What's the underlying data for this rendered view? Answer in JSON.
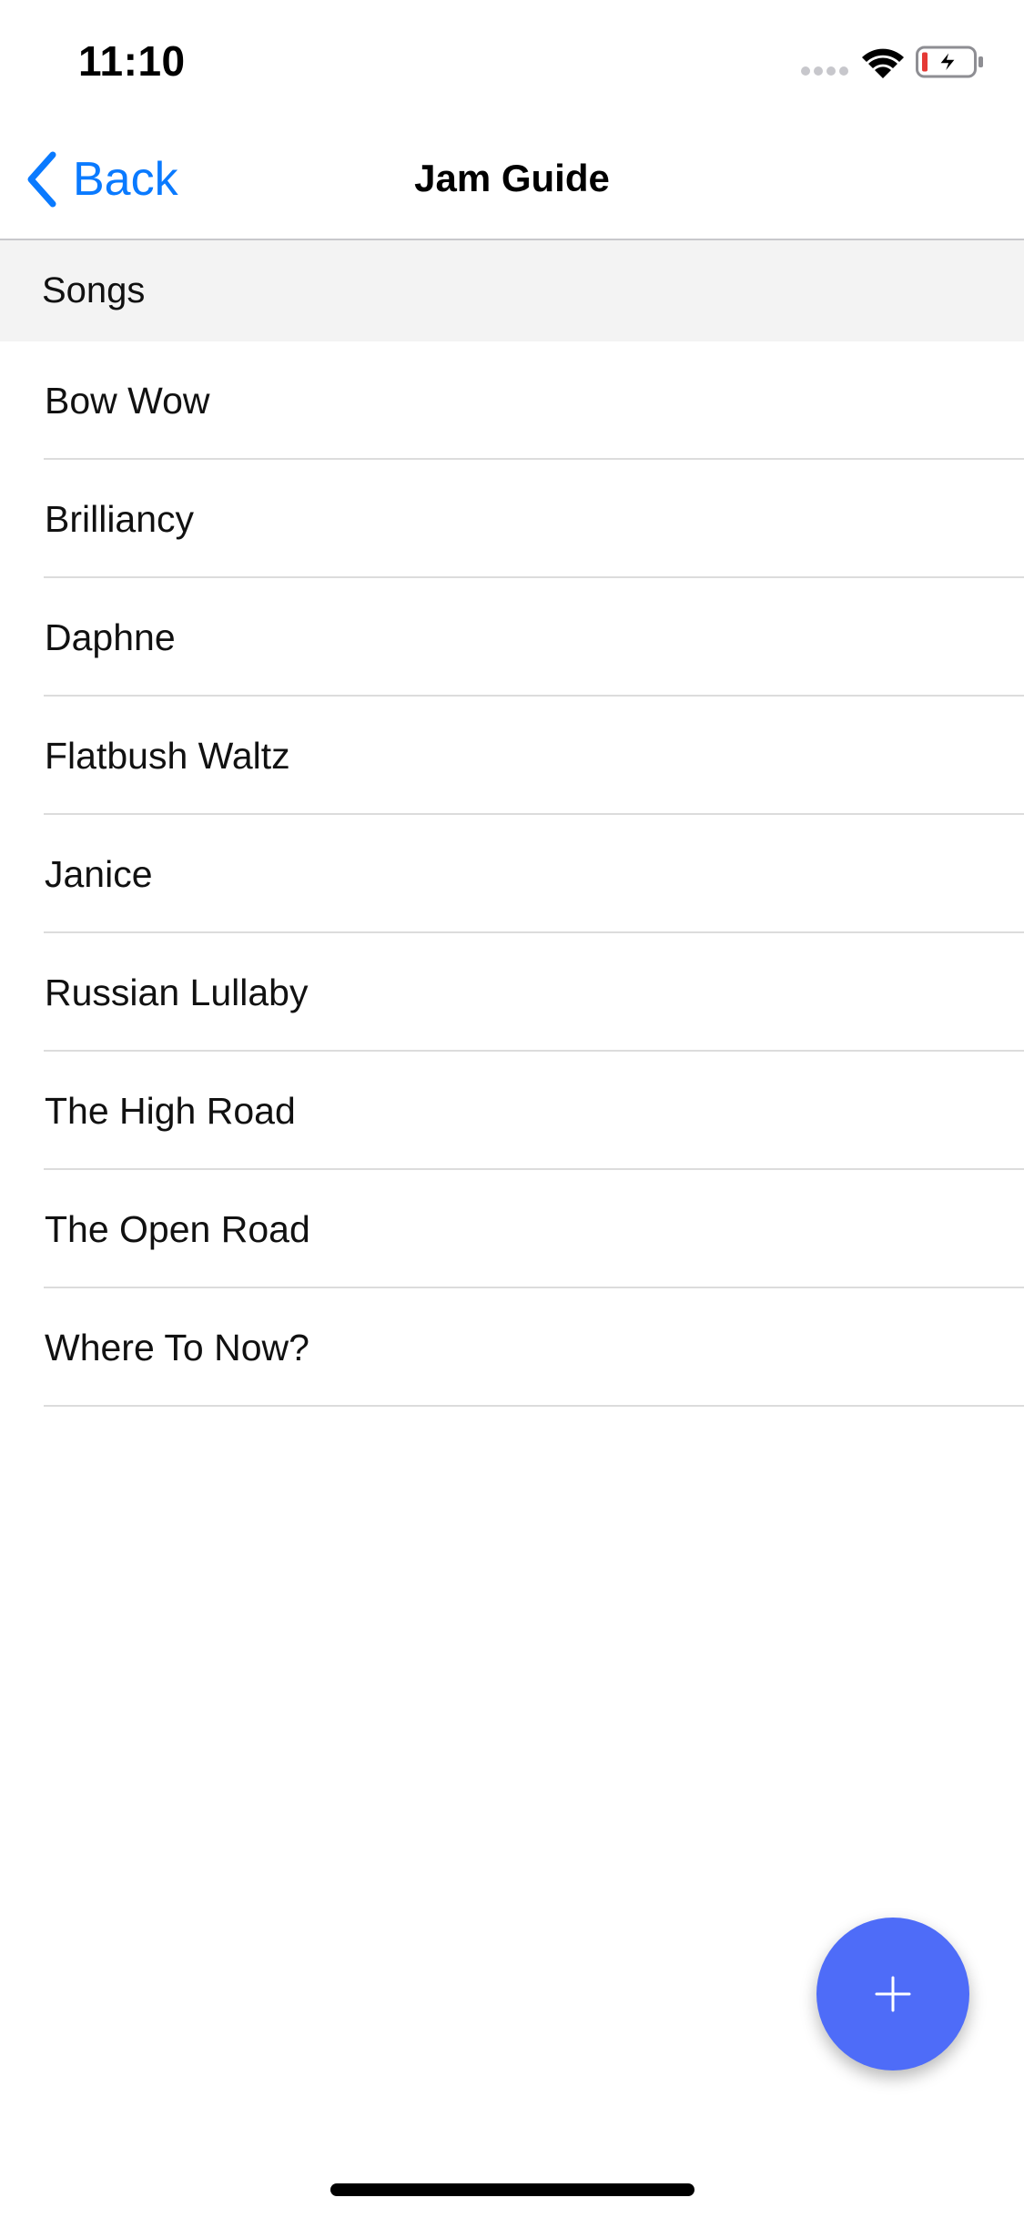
{
  "status_bar": {
    "time": "11:10",
    "icons": [
      "cellular-signal-icon",
      "wifi-icon",
      "battery-charging-icon"
    ]
  },
  "nav_bar": {
    "back_label": "Back",
    "title": "Jam Guide"
  },
  "section": {
    "header": "Songs"
  },
  "songs": [
    "Bow Wow",
    "Brilliancy",
    "Daphne",
    "Flatbush Waltz",
    "Janice",
    "Russian Lullaby",
    "The High Road",
    "The Open Road",
    "Where To Now?"
  ],
  "fab": {
    "icon": "plus-icon"
  },
  "colors": {
    "accent_blue": "#0a7aff",
    "fab_blue": "#4e6cf8",
    "section_bg": "#f3f3f3",
    "separator": "#dcdcdc",
    "battery_low": "#e53935"
  }
}
